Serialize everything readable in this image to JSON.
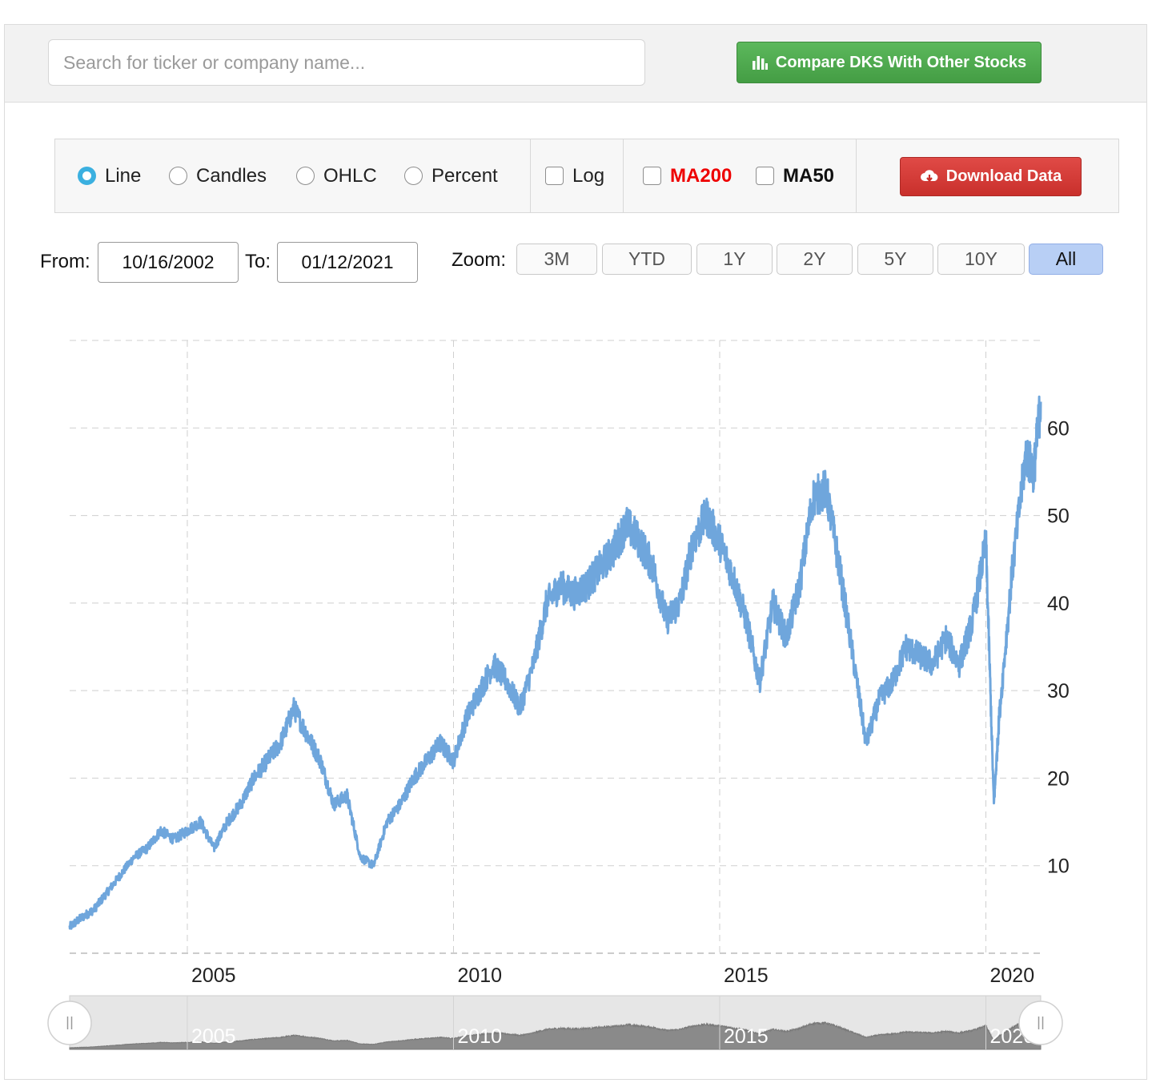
{
  "search": {
    "placeholder": "Search for ticker or company name..."
  },
  "compare_button": {
    "label": "Compare DKS With Other Stocks",
    "icon": "bar-chart-icon"
  },
  "chart_types": [
    {
      "label": "Line",
      "selected": true
    },
    {
      "label": "Candles",
      "selected": false
    },
    {
      "label": "OHLC",
      "selected": false
    },
    {
      "label": "Percent",
      "selected": false
    }
  ],
  "options": {
    "log": "Log",
    "ma200": "MA200",
    "ma50": "MA50"
  },
  "download_button": {
    "label": "Download Data",
    "icon": "cloud-download-icon"
  },
  "range": {
    "from_label": "From:",
    "from": "10/16/2002",
    "to_label": "To:",
    "to": "01/12/2021"
  },
  "zoom": {
    "label": "Zoom:",
    "buttons": [
      "3M",
      "YTD",
      "1Y",
      "2Y",
      "5Y",
      "10Y",
      "All"
    ],
    "active": "All"
  },
  "colors": {
    "line": "#6fa6dc",
    "ma200": "#ee0000",
    "compare": "#4cae4c",
    "download": "#d43f3a",
    "navigator": "#8a8a8a"
  },
  "chart_data": {
    "type": "line",
    "title": "",
    "xlabel": "",
    "ylabel": "",
    "ylim": [
      0,
      70
    ],
    "y_ticks": [
      10,
      20,
      30,
      40,
      50,
      60
    ],
    "x_ticks": [
      "2005",
      "2010",
      "2015",
      "2020"
    ],
    "navigator_labels": [
      "2005",
      "2010",
      "2015",
      "2020"
    ],
    "grid": true,
    "series": [
      {
        "x": [
          2002.79,
          2003.0,
          2003.25,
          2003.5,
          2003.75,
          2004.0,
          2004.25,
          2004.5,
          2004.75,
          2005.0,
          2005.25,
          2005.5,
          2005.75,
          2006.0,
          2006.25,
          2006.5,
          2006.75,
          2007.0,
          2007.25,
          2007.5,
          2007.75,
          2008.0,
          2008.25,
          2008.5,
          2008.75,
          2009.0,
          2009.25,
          2009.5,
          2009.75,
          2010.0,
          2010.25,
          2010.5,
          2010.75,
          2011.0,
          2011.25,
          2011.5,
          2011.75,
          2012.0,
          2012.25,
          2012.5,
          2012.75,
          2013.0,
          2013.25,
          2013.5,
          2013.75,
          2014.0,
          2014.25,
          2014.5,
          2014.75,
          2015.0,
          2015.25,
          2015.5,
          2015.75,
          2016.0,
          2016.25,
          2016.5,
          2016.75,
          2017.0,
          2017.25,
          2017.5,
          2017.75,
          2018.0,
          2018.25,
          2018.5,
          2018.75,
          2019.0,
          2019.25,
          2019.5,
          2019.75,
          2020.0,
          2020.15,
          2020.25,
          2020.5,
          2020.75,
          2020.9,
          2021.03
        ],
        "values": [
          3,
          4,
          5,
          7,
          9,
          11,
          12,
          14,
          13,
          14,
          15,
          12,
          15,
          17,
          20,
          22,
          24,
          28,
          25,
          22,
          17,
          18,
          11,
          10,
          15,
          17,
          20,
          22,
          24,
          22,
          27,
          30,
          33,
          31,
          28,
          33,
          40,
          42,
          41,
          42,
          44,
          46,
          49,
          47,
          44,
          38,
          40,
          47,
          50,
          47,
          43,
          38,
          31,
          40,
          36,
          42,
          52,
          53,
          44,
          34,
          24,
          29,
          31,
          35,
          34,
          33,
          36,
          33,
          38,
          47,
          17,
          27,
          44,
          57,
          55,
          63
        ]
      }
    ]
  }
}
